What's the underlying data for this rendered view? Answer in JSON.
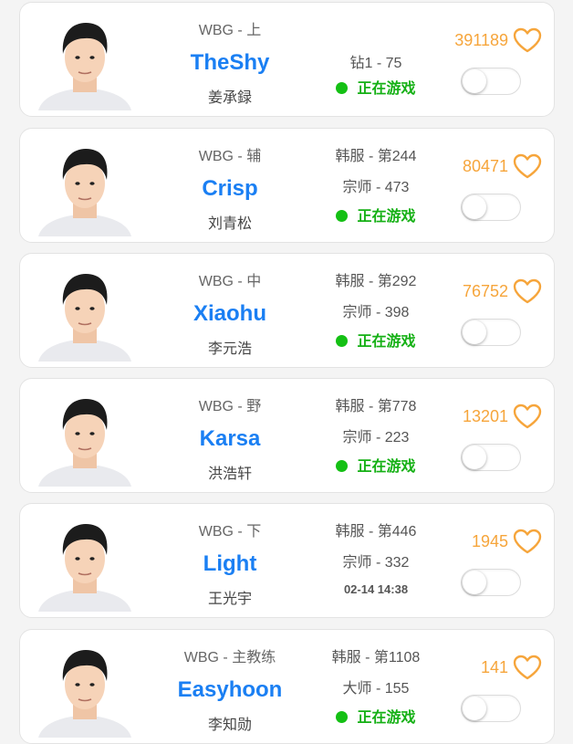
{
  "colors": {
    "nick": "#1a7ff3",
    "online": "#14b014",
    "likes": "#f6a53b"
  },
  "players": [
    {
      "team_pos": "WBG - 上",
      "nickname": "TheShy",
      "real_name": "姜承録",
      "server_rank": "",
      "tier": "钻1 - 75",
      "status": "正在游戏",
      "last_seen": "",
      "likes": "391189",
      "subscribed": false
    },
    {
      "team_pos": "WBG - 辅",
      "nickname": "Crisp",
      "real_name": "刘青松",
      "server_rank": "韩服 - 第244",
      "tier": "宗师 - 473",
      "status": "正在游戏",
      "last_seen": "",
      "likes": "80471",
      "subscribed": false
    },
    {
      "team_pos": "WBG - 中",
      "nickname": "Xiaohu",
      "real_name": "李元浩",
      "server_rank": "韩服 - 第292",
      "tier": "宗师 - 398",
      "status": "正在游戏",
      "last_seen": "",
      "likes": "76752",
      "subscribed": false
    },
    {
      "team_pos": "WBG - 野",
      "nickname": "Karsa",
      "real_name": "洪浩轩",
      "server_rank": "韩服 - 第778",
      "tier": "宗师 - 223",
      "status": "正在游戏",
      "last_seen": "",
      "likes": "13201",
      "subscribed": false
    },
    {
      "team_pos": "WBG - 下",
      "nickname": "Light",
      "real_name": "王光宇",
      "server_rank": "韩服 - 第446",
      "tier": "宗师 - 332",
      "status": "",
      "last_seen": "02-14 14:38",
      "likes": "1945",
      "subscribed": false
    },
    {
      "team_pos": "WBG - 主教练",
      "nickname": "Easyhoon",
      "real_name": "李知勋",
      "server_rank": "韩服 - 第1108",
      "tier": "大师 - 155",
      "status": "正在游戏",
      "last_seen": "",
      "likes": "141",
      "subscribed": false
    }
  ]
}
